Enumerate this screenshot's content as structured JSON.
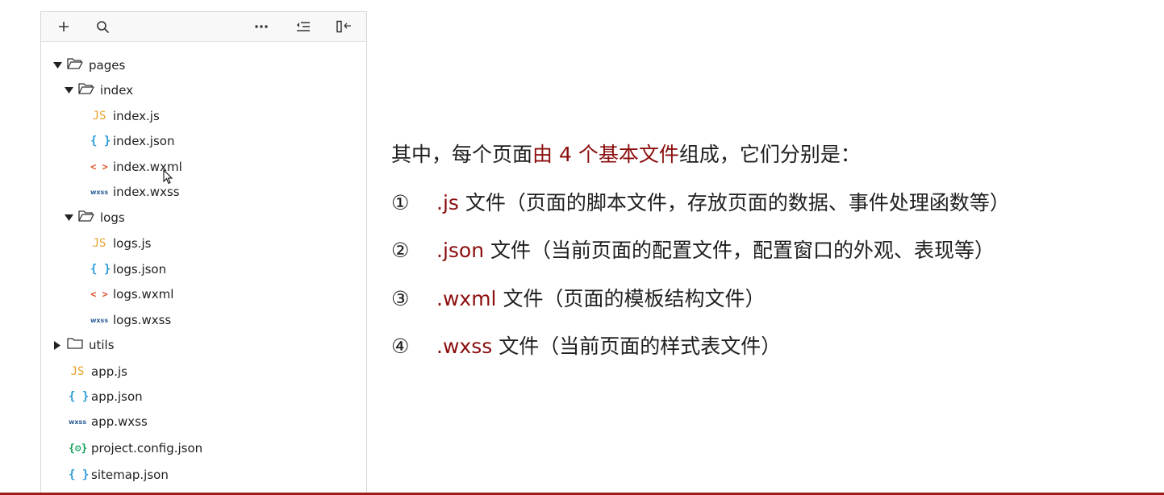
{
  "toolbar": {
    "new_icon": "plus-icon",
    "search_icon": "search-icon",
    "more_icon": "ellipsis-icon",
    "collapse_icon": "collapse-all-icon",
    "panel_icon": "toggle-panel-icon"
  },
  "tree": {
    "pages": "pages",
    "index": "index",
    "index_js": "index.js",
    "index_json": "index.json",
    "index_wxml": "index.wxml",
    "index_wxss": "index.wxss",
    "logs": "logs",
    "logs_js": "logs.js",
    "logs_json": "logs.json",
    "logs_wxml": "logs.wxml",
    "logs_wxss": "logs.wxss",
    "utils": "utils",
    "app_js": "app.js",
    "app_json": "app.json",
    "app_wxss": "app.wxss",
    "project_config": "project.config.json",
    "sitemap": "sitemap.json"
  },
  "icons": {
    "js": "JS",
    "json": "{ }",
    "wxml": "< >",
    "wxss": "wxss",
    "config": "{⚙}"
  },
  "content": {
    "intro_a": "其中，每个页面",
    "intro_red": "由 4 个基本文件",
    "intro_b": "组成，它们分别是：",
    "items": [
      {
        "num": "①",
        "ext": ".js",
        "desc": " 文件（页面的脚本文件，存放页面的数据、事件处理函数等）"
      },
      {
        "num": "②",
        "ext": ".json",
        "desc": " 文件（当前页面的配置文件，配置窗口的外观、表现等）"
      },
      {
        "num": "③",
        "ext": ".wxml",
        "desc": " 文件（页面的模板结构文件）"
      },
      {
        "num": "④",
        "ext": ".wxss",
        "desc": " 文件（当前页面的样式表文件）"
      }
    ]
  },
  "colors": {
    "accent_red": "#8b0e0e",
    "bottom_bar": "#9b1c1c",
    "js_icon": "#e7a32b",
    "json_icon": "#2e9bd6",
    "wxml_icon": "#e0532e",
    "wxss_icon": "#2c5e96"
  }
}
